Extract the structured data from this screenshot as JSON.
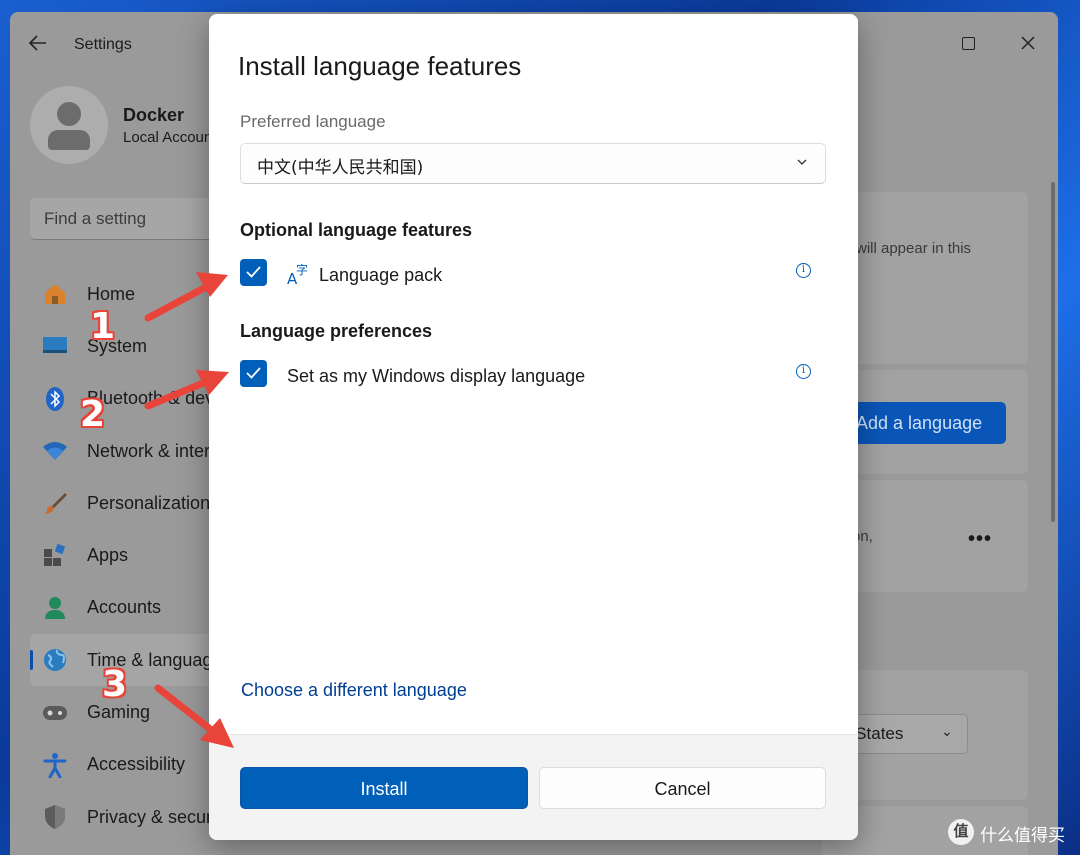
{
  "settings": {
    "title": "Settings",
    "user": {
      "name": "Docker",
      "account_type": "Local Account"
    },
    "search_placeholder": "Find a setting",
    "nav": [
      {
        "label": "Home",
        "icon": "home-icon"
      },
      {
        "label": "System",
        "icon": "system-icon"
      },
      {
        "label": "Bluetooth & devices",
        "icon": "bluetooth-icon"
      },
      {
        "label": "Network & internet",
        "icon": "wifi-icon"
      },
      {
        "label": "Personalization",
        "icon": "brush-icon"
      },
      {
        "label": "Apps",
        "icon": "apps-icon"
      },
      {
        "label": "Accounts",
        "icon": "account-icon"
      },
      {
        "label": "Time & language",
        "icon": "globe-icon",
        "selected": true
      },
      {
        "label": "Gaming",
        "icon": "gamepad-icon"
      },
      {
        "label": "Accessibility",
        "icon": "accessibility-icon"
      },
      {
        "label": "Privacy & security",
        "icon": "shield-icon"
      }
    ],
    "right": {
      "card1_text": "will appear in this",
      "add_language_label": "Add a language",
      "card3_text": "on,",
      "region_value": "d States"
    }
  },
  "dialog": {
    "title": "Install language features",
    "preferred_label": "Preferred language",
    "preferred_value": "中文(中华人民共和国)",
    "optional_heading": "Optional language features",
    "language_pack_label": "Language pack",
    "language_pack_checked": true,
    "preferences_heading": "Language preferences",
    "display_language_label": "Set as my Windows display language",
    "display_language_checked": true,
    "choose_link": "Choose a different language",
    "install_label": "Install",
    "cancel_label": "Cancel"
  },
  "annotations": [
    "1",
    "2",
    "3"
  ],
  "watermark": {
    "logo_char": "值",
    "text": "什么值得买"
  },
  "colors": {
    "accent": "#005fb8",
    "annotation": "#e8443a"
  }
}
